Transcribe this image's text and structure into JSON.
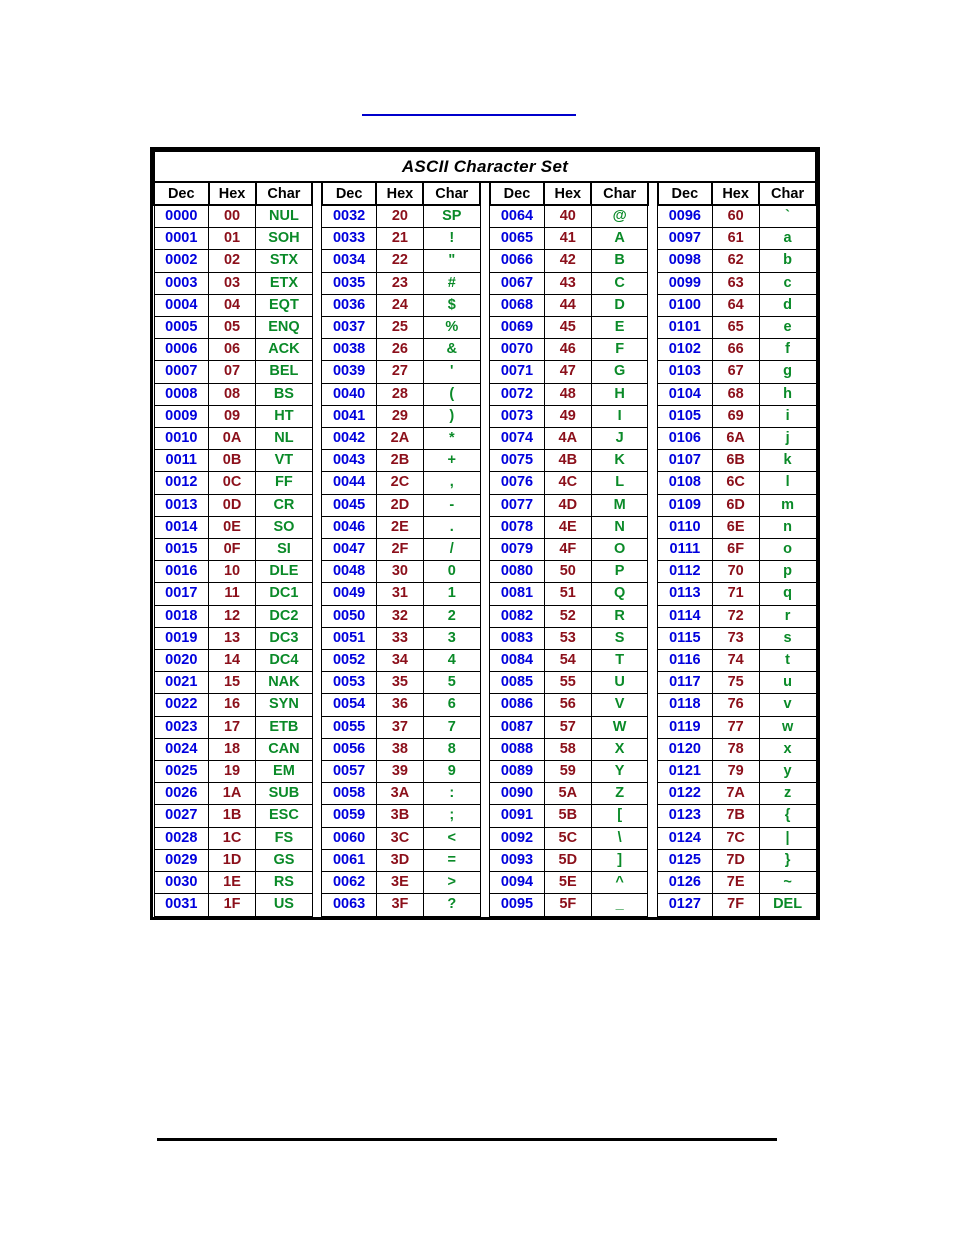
{
  "page": {
    "top_rule_color": "#0000cc",
    "bottom_rule_color": "#000000"
  },
  "table": {
    "title": "ASCII Character Set",
    "columns": [
      "Dec",
      "Hex",
      "Char"
    ],
    "colors": {
      "dec": "#0000dd",
      "hex": "#8b0f1a",
      "char": "#0a8a28",
      "border": "#000000"
    },
    "groups": [
      {
        "headers": [
          "Dec",
          "Hex",
          "Char"
        ],
        "rows": [
          [
            "0000",
            "00",
            "NUL"
          ],
          [
            "0001",
            "01",
            "SOH"
          ],
          [
            "0002",
            "02",
            "STX"
          ],
          [
            "0003",
            "03",
            "ETX"
          ],
          [
            "0004",
            "04",
            "EQT"
          ],
          [
            "0005",
            "05",
            "ENQ"
          ],
          [
            "0006",
            "06",
            "ACK"
          ],
          [
            "0007",
            "07",
            "BEL"
          ],
          [
            "0008",
            "08",
            "BS"
          ],
          [
            "0009",
            "09",
            "HT"
          ],
          [
            "0010",
            "0A",
            "NL"
          ],
          [
            "0011",
            "0B",
            "VT"
          ],
          [
            "0012",
            "0C",
            "FF"
          ],
          [
            "0013",
            "0D",
            "CR"
          ],
          [
            "0014",
            "0E",
            "SO"
          ],
          [
            "0015",
            "0F",
            "SI"
          ],
          [
            "0016",
            "10",
            "DLE"
          ],
          [
            "0017",
            "11",
            "DC1"
          ],
          [
            "0018",
            "12",
            "DC2"
          ],
          [
            "0019",
            "13",
            "DC3"
          ],
          [
            "0020",
            "14",
            "DC4"
          ],
          [
            "0021",
            "15",
            "NAK"
          ],
          [
            "0022",
            "16",
            "SYN"
          ],
          [
            "0023",
            "17",
            "ETB"
          ],
          [
            "0024",
            "18",
            "CAN"
          ],
          [
            "0025",
            "19",
            "EM"
          ],
          [
            "0026",
            "1A",
            "SUB"
          ],
          [
            "0027",
            "1B",
            "ESC"
          ],
          [
            "0028",
            "1C",
            "FS"
          ],
          [
            "0029",
            "1D",
            "GS"
          ],
          [
            "0030",
            "1E",
            "RS"
          ],
          [
            "0031",
            "1F",
            "US"
          ]
        ]
      },
      {
        "headers": [
          "Dec",
          "Hex",
          "Char"
        ],
        "rows": [
          [
            "0032",
            "20",
            "SP"
          ],
          [
            "0033",
            "21",
            "!"
          ],
          [
            "0034",
            "22",
            "\""
          ],
          [
            "0035",
            "23",
            "#"
          ],
          [
            "0036",
            "24",
            "$"
          ],
          [
            "0037",
            "25",
            "%"
          ],
          [
            "0038",
            "26",
            "&"
          ],
          [
            "0039",
            "27",
            "'"
          ],
          [
            "0040",
            "28",
            "("
          ],
          [
            "0041",
            "29",
            ")"
          ],
          [
            "0042",
            "2A",
            "*"
          ],
          [
            "0043",
            "2B",
            "+"
          ],
          [
            "0044",
            "2C",
            ","
          ],
          [
            "0045",
            "2D",
            "-"
          ],
          [
            "0046",
            "2E",
            "."
          ],
          [
            "0047",
            "2F",
            "/"
          ],
          [
            "0048",
            "30",
            "0"
          ],
          [
            "0049",
            "31",
            "1"
          ],
          [
            "0050",
            "32",
            "2"
          ],
          [
            "0051",
            "33",
            "3"
          ],
          [
            "0052",
            "34",
            "4"
          ],
          [
            "0053",
            "35",
            "5"
          ],
          [
            "0054",
            "36",
            "6"
          ],
          [
            "0055",
            "37",
            "7"
          ],
          [
            "0056",
            "38",
            "8"
          ],
          [
            "0057",
            "39",
            "9"
          ],
          [
            "0058",
            "3A",
            ":"
          ],
          [
            "0059",
            "3B",
            ";"
          ],
          [
            "0060",
            "3C",
            "<"
          ],
          [
            "0061",
            "3D",
            "="
          ],
          [
            "0062",
            "3E",
            ">"
          ],
          [
            "0063",
            "3F",
            "?"
          ]
        ]
      },
      {
        "headers": [
          "Dec",
          "Hex",
          "Char"
        ],
        "rows": [
          [
            "0064",
            "40",
            "@"
          ],
          [
            "0065",
            "41",
            "A"
          ],
          [
            "0066",
            "42",
            "B"
          ],
          [
            "0067",
            "43",
            "C"
          ],
          [
            "0068",
            "44",
            "D"
          ],
          [
            "0069",
            "45",
            "E"
          ],
          [
            "0070",
            "46",
            "F"
          ],
          [
            "0071",
            "47",
            "G"
          ],
          [
            "0072",
            "48",
            "H"
          ],
          [
            "0073",
            "49",
            "I"
          ],
          [
            "0074",
            "4A",
            "J"
          ],
          [
            "0075",
            "4B",
            "K"
          ],
          [
            "0076",
            "4C",
            "L"
          ],
          [
            "0077",
            "4D",
            "M"
          ],
          [
            "0078",
            "4E",
            "N"
          ],
          [
            "0079",
            "4F",
            "O"
          ],
          [
            "0080",
            "50",
            "P"
          ],
          [
            "0081",
            "51",
            "Q"
          ],
          [
            "0082",
            "52",
            "R"
          ],
          [
            "0083",
            "53",
            "S"
          ],
          [
            "0084",
            "54",
            "T"
          ],
          [
            "0085",
            "55",
            "U"
          ],
          [
            "0086",
            "56",
            "V"
          ],
          [
            "0087",
            "57",
            "W"
          ],
          [
            "0088",
            "58",
            "X"
          ],
          [
            "0089",
            "59",
            "Y"
          ],
          [
            "0090",
            "5A",
            "Z"
          ],
          [
            "0091",
            "5B",
            "["
          ],
          [
            "0092",
            "5C",
            "\\"
          ],
          [
            "0093",
            "5D",
            "]"
          ],
          [
            "0094",
            "5E",
            "^"
          ],
          [
            "0095",
            "5F",
            "_"
          ]
        ]
      },
      {
        "headers": [
          "Dec",
          "Hex",
          "Char"
        ],
        "rows": [
          [
            "0096",
            "60",
            "`"
          ],
          [
            "0097",
            "61",
            "a"
          ],
          [
            "0098",
            "62",
            "b"
          ],
          [
            "0099",
            "63",
            "c"
          ],
          [
            "0100",
            "64",
            "d"
          ],
          [
            "0101",
            "65",
            "e"
          ],
          [
            "0102",
            "66",
            "f"
          ],
          [
            "0103",
            "67",
            "g"
          ],
          [
            "0104",
            "68",
            "h"
          ],
          [
            "0105",
            "69",
            "i"
          ],
          [
            "0106",
            "6A",
            "j"
          ],
          [
            "0107",
            "6B",
            "k"
          ],
          [
            "0108",
            "6C",
            "l"
          ],
          [
            "0109",
            "6D",
            "m"
          ],
          [
            "0110",
            "6E",
            "n"
          ],
          [
            "0111",
            "6F",
            "o"
          ],
          [
            "0112",
            "70",
            "p"
          ],
          [
            "0113",
            "71",
            "q"
          ],
          [
            "0114",
            "72",
            "r"
          ],
          [
            "0115",
            "73",
            "s"
          ],
          [
            "0116",
            "74",
            "t"
          ],
          [
            "0117",
            "75",
            "u"
          ],
          [
            "0118",
            "76",
            "v"
          ],
          [
            "0119",
            "77",
            "w"
          ],
          [
            "0120",
            "78",
            "x"
          ],
          [
            "0121",
            "79",
            "y"
          ],
          [
            "0122",
            "7A",
            "z"
          ],
          [
            "0123",
            "7B",
            "{"
          ],
          [
            "0124",
            "7C",
            "|"
          ],
          [
            "0125",
            "7D",
            "}"
          ],
          [
            "0126",
            "7E",
            "~"
          ],
          [
            "0127",
            "7F",
            "DEL"
          ]
        ]
      }
    ]
  }
}
